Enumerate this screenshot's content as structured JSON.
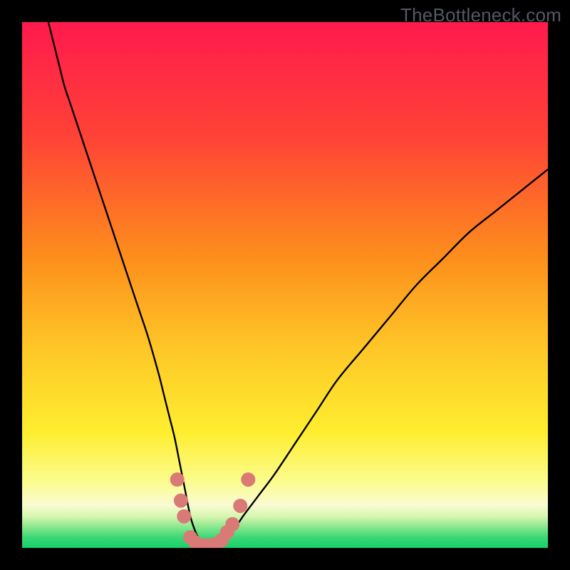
{
  "watermark": "TheBottleneck.com",
  "chart_data": {
    "type": "line",
    "title": "",
    "xlabel": "",
    "ylabel": "",
    "xlim": [
      0,
      100
    ],
    "ylim": [
      0,
      100
    ],
    "grid": false,
    "legend": false,
    "annotations": [],
    "gradient_stops": [
      {
        "offset": 0.0,
        "color": "#ff1a4d"
      },
      {
        "offset": 0.22,
        "color": "#ff4336"
      },
      {
        "offset": 0.45,
        "color": "#fd8f1c"
      },
      {
        "offset": 0.62,
        "color": "#fec727"
      },
      {
        "offset": 0.78,
        "color": "#feee2f"
      },
      {
        "offset": 0.875,
        "color": "#fbfc8f"
      },
      {
        "offset": 0.918,
        "color": "#f9fbd2"
      },
      {
        "offset": 0.94,
        "color": "#d7f6b0"
      },
      {
        "offset": 0.96,
        "color": "#8be78d"
      },
      {
        "offset": 0.98,
        "color": "#3bd776"
      },
      {
        "offset": 1.0,
        "color": "#17d169"
      }
    ],
    "series": [
      {
        "name": "bottleneck-curve",
        "color": "#000000",
        "x": [
          5,
          6,
          7,
          8,
          9,
          10,
          12,
          14,
          16,
          18,
          20,
          22,
          24,
          26,
          27,
          28,
          29,
          30,
          31,
          32,
          33,
          34,
          35,
          36,
          38,
          40,
          42,
          45,
          48,
          52,
          56,
          60,
          65,
          70,
          75,
          80,
          85,
          90,
          95,
          100
        ],
        "y": [
          100,
          96,
          92,
          88,
          85,
          82,
          76,
          70,
          64,
          58,
          52,
          46,
          40,
          33,
          29,
          25,
          21,
          16,
          11,
          6,
          3,
          1,
          0,
          0,
          1,
          3,
          6,
          10,
          14,
          20,
          26,
          32,
          38,
          44,
          50,
          55,
          60,
          64,
          68,
          72
        ]
      }
    ],
    "markers": {
      "name": "highlight-dots",
      "color": "#d97a76",
      "radius_px": 10,
      "points": [
        {
          "x": 29.5,
          "y": 13
        },
        {
          "x": 30.2,
          "y": 9
        },
        {
          "x": 30.8,
          "y": 6
        },
        {
          "x": 32.0,
          "y": 2
        },
        {
          "x": 33.0,
          "y": 1
        },
        {
          "x": 34.0,
          "y": 0.5
        },
        {
          "x": 35.0,
          "y": 0.5
        },
        {
          "x": 36.0,
          "y": 0.5
        },
        {
          "x": 37.0,
          "y": 0.8
        },
        {
          "x": 38.0,
          "y": 1.5
        },
        {
          "x": 39.0,
          "y": 3
        },
        {
          "x": 40.0,
          "y": 4.5
        },
        {
          "x": 41.5,
          "y": 8
        },
        {
          "x": 43.0,
          "y": 13
        }
      ]
    }
  }
}
